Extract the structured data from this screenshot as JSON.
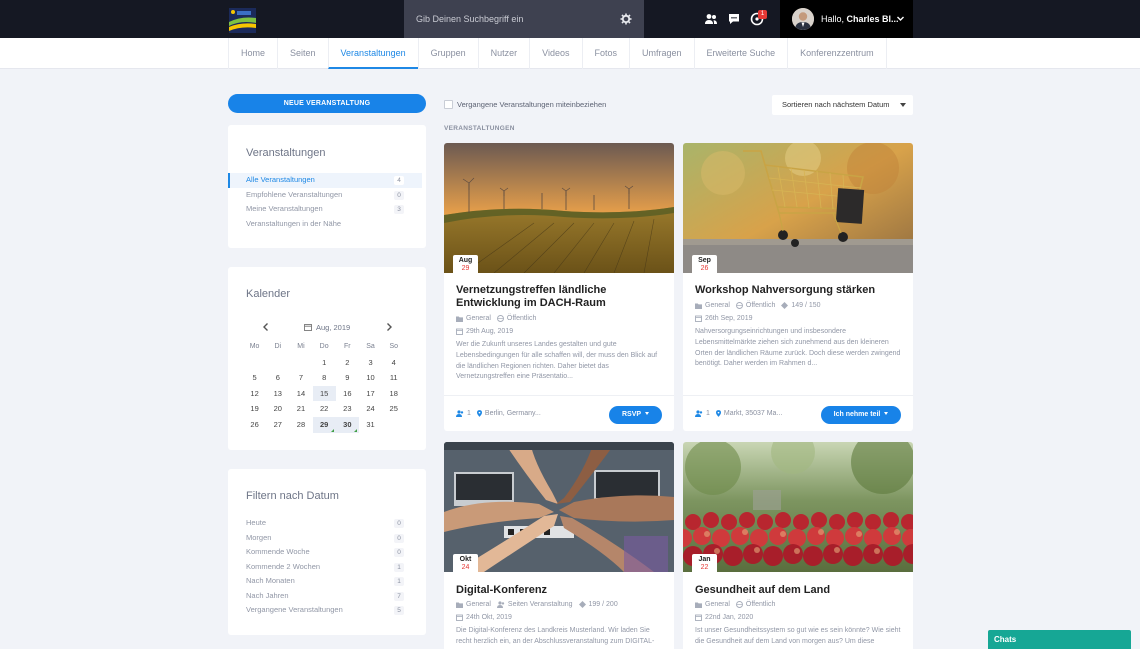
{
  "colors": {
    "accent": "#1883e8",
    "topbar": "#151823",
    "chats": "#16a795",
    "badge": "#e53935"
  },
  "header": {
    "search_placeholder": "Gib Deinen Suchbegriff ein",
    "notification_count": "1",
    "greeting": "Hallo,",
    "user_name": "Charles Bl..."
  },
  "nav": {
    "tabs": [
      "Home",
      "Seiten",
      "Veranstaltungen",
      "Gruppen",
      "Nutzer",
      "Videos",
      "Fotos",
      "Umfragen",
      "Erweiterte Suche",
      "Konferenzzentrum"
    ],
    "active": "Veranstaltungen"
  },
  "sidebar": {
    "new_button": "NEUE VERANSTALTUNG",
    "events_box": {
      "title": "Veranstaltungen",
      "items": [
        {
          "label": "Alle Veranstaltungen",
          "count": "4"
        },
        {
          "label": "Empfohlene Veranstaltungen",
          "count": "0"
        },
        {
          "label": "Meine Veranstaltungen",
          "count": "3"
        },
        {
          "label": "Veranstaltungen in der Nähe",
          "count": ""
        }
      ]
    },
    "calendar": {
      "title": "Kalender",
      "month": "Aug, 2019",
      "weekdays": [
        "Mo",
        "Di",
        "Mi",
        "Do",
        "Fr",
        "Sa",
        "So"
      ],
      "weeks": [
        [
          "",
          "",
          "",
          "1",
          "2",
          "3",
          "4"
        ],
        [
          "5",
          "6",
          "7",
          "8",
          "9",
          "10",
          "11"
        ],
        [
          "12",
          "13",
          "14",
          "15",
          "16",
          "17",
          "18"
        ],
        [
          "19",
          "20",
          "21",
          "22",
          "23",
          "24",
          "25"
        ],
        [
          "26",
          "27",
          "28",
          "29",
          "30",
          "31",
          ""
        ]
      ],
      "highlight_day": "15",
      "event_days": [
        "29",
        "30"
      ]
    },
    "date_filter": {
      "title": "Filtern nach Datum",
      "items": [
        {
          "label": "Heute",
          "count": "0"
        },
        {
          "label": "Morgen",
          "count": "0"
        },
        {
          "label": "Kommende Woche",
          "count": "0"
        },
        {
          "label": "Kommende 2 Wochen",
          "count": "1"
        },
        {
          "label": "Nach Monaten",
          "count": "1"
        },
        {
          "label": "Nach Jahren",
          "count": "7"
        },
        {
          "label": "Vergangene Veranstaltungen",
          "count": "5"
        }
      ]
    }
  },
  "main": {
    "past_checkbox_label": "Vergangene Veranstaltungen miteinbeziehen",
    "sort_label": "Sortieren nach nächstem Datum",
    "section_label": "VERANSTALTUNGEN",
    "events": [
      {
        "month": "Aug",
        "day": "29",
        "title": "Vernetzungstreffen ländliche Entwicklung im DACH-Raum",
        "category": "General",
        "visibility": "Öffentlich",
        "extra": "",
        "date": "29th Aug, 2019",
        "description": "Wer die Zukunft unseres Landes gestalten und gute Lebensbedingungen für alle schaffen will, der muss den Blick auf die ländlichen Regionen richten. Daher bietet das Vernetzungstreffen eine Präsentatio...",
        "attendees": "1",
        "location": "Berlin, Germany...",
        "button": "RSVP"
      },
      {
        "month": "Sep",
        "day": "26",
        "title": "Workshop Nahversorgung stärken",
        "category": "General",
        "visibility": "Öffentlich",
        "extra": "149 / 150",
        "date": "26th Sep, 2019",
        "description": "Nahversorgungseinrichtungen und insbesondere Lebensmittelmärkte ziehen sich zunehmend aus den kleineren Orten der ländlichen Räume zurück. Doch diese werden zwingend benötigt. Daher werden im Rahmen d...",
        "attendees": "1",
        "location": "Markt, 35037 Ma...",
        "button": "Ich nehme teil"
      },
      {
        "month": "Okt",
        "day": "24",
        "title": "Digital-Konferenz",
        "category": "General",
        "visibility": "Seiten Veranstaltung",
        "extra": "199 / 200",
        "date": "24th Okt, 2019",
        "description": "Die Digital-Konferenz des Landkreis Musterland. Wir laden Sie recht herzlich ein, an der Abschlussveranstaltung zum DIGITAL-"
      },
      {
        "month": "Jan",
        "day": "22",
        "title": "Gesundheit auf dem Land",
        "category": "General",
        "visibility": "Öffentlich",
        "extra": "",
        "date": "22nd Jan, 2020",
        "description": "Ist unser Gesundheitssystem so gut wie es sein könnte? Wie sieht die Gesundheit auf dem Land von morgen aus? Um diese"
      }
    ]
  },
  "chat": {
    "label": "Chats"
  }
}
